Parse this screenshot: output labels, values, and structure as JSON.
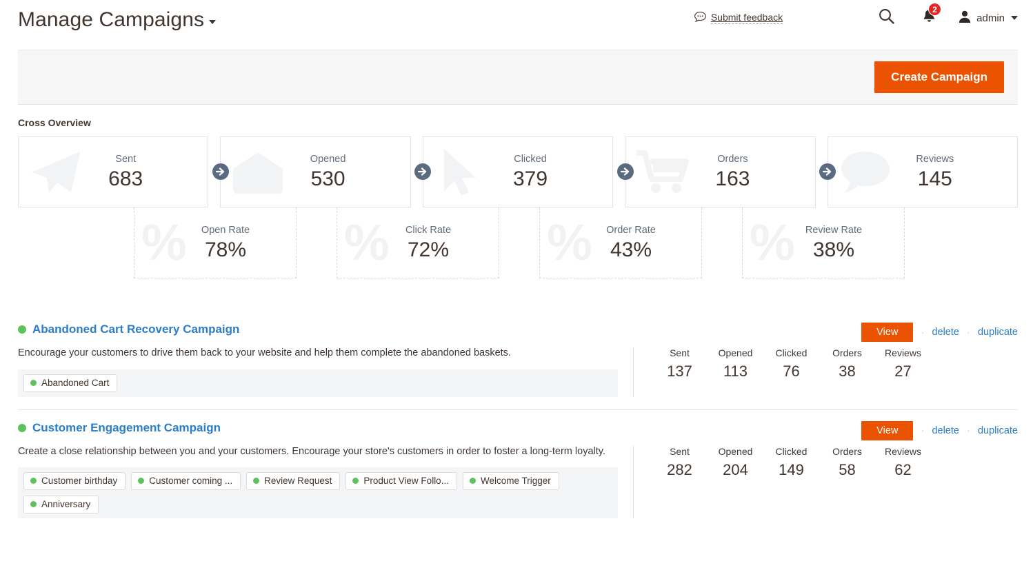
{
  "header": {
    "title": "Manage Campaigns",
    "feedback_label": "Submit feedback",
    "feedback_icon": "speech-bubble-icon",
    "search_icon": "search-icon",
    "bell_icon": "bell-icon",
    "notification_count": "2",
    "user_icon": "user-icon",
    "user_label": "admin"
  },
  "toolbar": {
    "create_label": "Create Campaign"
  },
  "overview": {
    "section_title": "Cross Overview",
    "stats": [
      {
        "label": "Sent",
        "value": "683",
        "icon": "paper-plane-icon"
      },
      {
        "label": "Opened",
        "value": "530",
        "icon": "envelope-icon"
      },
      {
        "label": "Clicked",
        "value": "379",
        "icon": "cursor-arrow-icon"
      },
      {
        "label": "Orders",
        "value": "163",
        "icon": "shopping-cart-icon"
      },
      {
        "label": "Reviews",
        "value": "145",
        "icon": "speech-bubble-icon"
      }
    ],
    "rates": [
      {
        "label": "Open Rate",
        "value": "78%",
        "icon": "percent-icon"
      },
      {
        "label": "Click Rate",
        "value": "72%",
        "icon": "percent-icon"
      },
      {
        "label": "Order Rate",
        "value": "43%",
        "icon": "percent-icon"
      },
      {
        "label": "Review Rate",
        "value": "38%",
        "icon": "percent-icon"
      }
    ]
  },
  "campaigns": {
    "metric_labels": [
      "Sent",
      "Opened",
      "Clicked",
      "Orders",
      "Reviews"
    ],
    "actions": {
      "view": "View",
      "delete": "delete",
      "duplicate": "duplicate",
      "separator": "·"
    },
    "items": [
      {
        "title": "Abandoned Cart Recovery Campaign",
        "status": "active",
        "description": "Encourage your customers to drive them back to your website and help them complete the abandoned baskets.",
        "chips": [
          "Abandoned Cart"
        ],
        "metrics": [
          "137",
          "113",
          "76",
          "38",
          "27"
        ]
      },
      {
        "title": "Customer Engagement Campaign",
        "status": "active",
        "description": "Create a close relationship between you and your customers. Encourage your store's customers in order to foster a long-term loyalty.",
        "chips": [
          "Customer birthday",
          "Customer coming ...",
          "Review Request",
          "Product View Follo...",
          "Welcome Trigger",
          "Anniversary"
        ],
        "metrics": [
          "282",
          "204",
          "149",
          "58",
          "62"
        ]
      }
    ]
  },
  "colors": {
    "accent_orange": "#eb5202",
    "link_blue": "#2a7ec9",
    "status_green": "#5cc35c",
    "badge_red": "#e22626",
    "arrow_slate": "#5b6b7f"
  }
}
